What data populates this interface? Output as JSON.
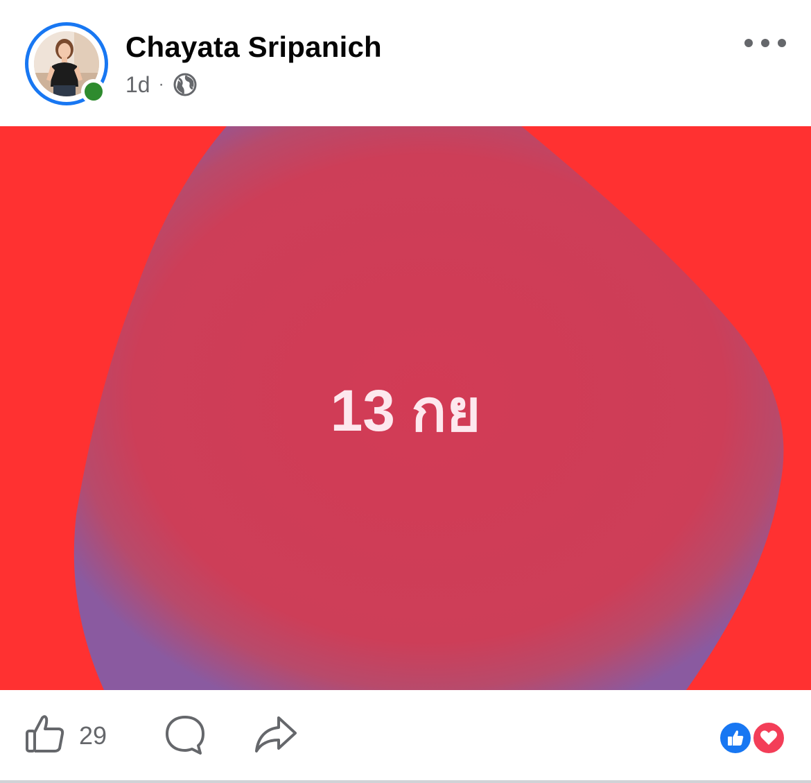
{
  "post": {
    "author": "Chayata Sripanich",
    "time": "1d",
    "separator": "·",
    "audience_icon": "globe-icon",
    "media_text": "13 กย",
    "colors": {
      "background": "#ff3131",
      "blob_center": "#d23b55",
      "blob_edge": "#8a5aa0",
      "accent": "#1877f2",
      "online": "#2e8b2e"
    }
  },
  "actions": {
    "like_count": "29",
    "like_icon": "thumbs-up-icon",
    "comment_icon": "comment-icon",
    "share_icon": "share-icon"
  },
  "reactions": [
    "like",
    "love"
  ]
}
